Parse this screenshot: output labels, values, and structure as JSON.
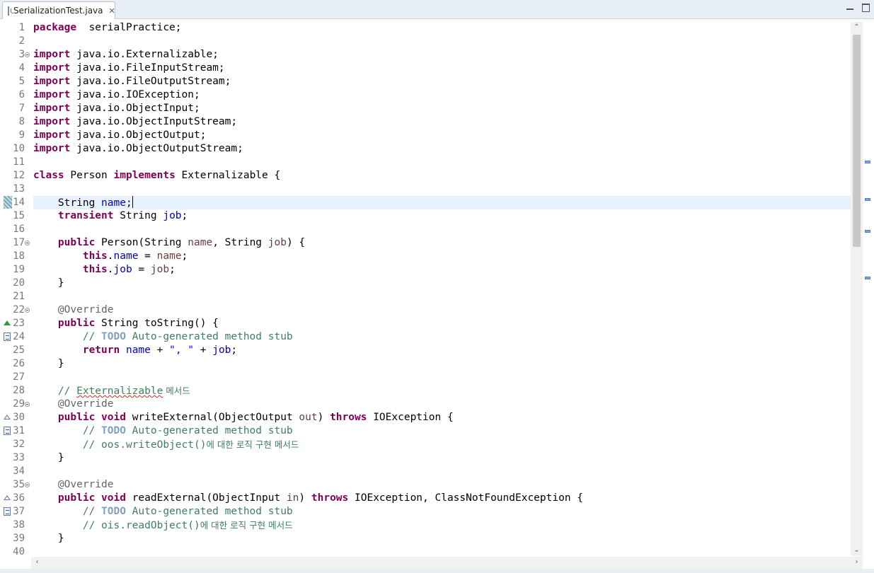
{
  "tab": {
    "title": "SerializationTest.java",
    "close_icon": "✕"
  },
  "window_buttons": {
    "minimize": "minimize",
    "maximize": "maximize"
  },
  "lines": [
    {
      "n": "1",
      "tokens": [
        [
          "kw",
          "package"
        ],
        [
          "",
          "  serialPractice;"
        ]
      ]
    },
    {
      "n": "2",
      "tokens": []
    },
    {
      "n": "3",
      "fold": true,
      "tokens": [
        [
          "kw",
          "import"
        ],
        [
          "",
          " java.io.Externalizable;"
        ]
      ]
    },
    {
      "n": "4",
      "tokens": [
        [
          "kw",
          "import"
        ],
        [
          "",
          " java.io.FileInputStream;"
        ]
      ]
    },
    {
      "n": "5",
      "tokens": [
        [
          "kw",
          "import"
        ],
        [
          "",
          " java.io.FileOutputStream;"
        ]
      ]
    },
    {
      "n": "6",
      "tokens": [
        [
          "kw",
          "import"
        ],
        [
          "",
          " java.io.IOException;"
        ]
      ]
    },
    {
      "n": "7",
      "tokens": [
        [
          "kw",
          "import"
        ],
        [
          "",
          " java.io.ObjectInput;"
        ]
      ]
    },
    {
      "n": "8",
      "tokens": [
        [
          "kw",
          "import"
        ],
        [
          "",
          " java.io.ObjectInputStream;"
        ]
      ]
    },
    {
      "n": "9",
      "tokens": [
        [
          "kw",
          "import"
        ],
        [
          "",
          " java.io.ObjectOutput;"
        ]
      ]
    },
    {
      "n": "10",
      "tokens": [
        [
          "kw",
          "import"
        ],
        [
          "",
          " java.io.ObjectOutputStream;"
        ]
      ]
    },
    {
      "n": "11",
      "tokens": []
    },
    {
      "n": "12",
      "tokens": [
        [
          "kw",
          "class"
        ],
        [
          "",
          " Person "
        ],
        [
          "kw",
          "implements"
        ],
        [
          "",
          " Externalizable {"
        ]
      ]
    },
    {
      "n": "13",
      "tokens": []
    },
    {
      "n": "14",
      "current": true,
      "marker": "cursor",
      "tokens": [
        [
          "",
          "    String "
        ],
        [
          "fld",
          "name"
        ],
        [
          "",
          ";"
        ],
        [
          "caret",
          ""
        ]
      ]
    },
    {
      "n": "15",
      "tokens": [
        [
          "",
          "    "
        ],
        [
          "kw",
          "transient"
        ],
        [
          "",
          " String "
        ],
        [
          "fld",
          "job"
        ],
        [
          "",
          ";"
        ]
      ]
    },
    {
      "n": "16",
      "tokens": []
    },
    {
      "n": "17",
      "fold": true,
      "tokens": [
        [
          "",
          "    "
        ],
        [
          "kw",
          "public"
        ],
        [
          "",
          " Person(String "
        ],
        [
          "prm",
          "name"
        ],
        [
          "",
          ", String "
        ],
        [
          "prm",
          "job"
        ],
        [
          "",
          ") {"
        ]
      ]
    },
    {
      "n": "18",
      "tokens": [
        [
          "",
          "        "
        ],
        [
          "kw",
          "this"
        ],
        [
          "",
          "."
        ],
        [
          "fld",
          "name"
        ],
        [
          "",
          " = "
        ],
        [
          "prm",
          "name"
        ],
        [
          "",
          ";"
        ]
      ]
    },
    {
      "n": "19",
      "tokens": [
        [
          "",
          "        "
        ],
        [
          "kw",
          "this"
        ],
        [
          "",
          "."
        ],
        [
          "fld",
          "job"
        ],
        [
          "",
          " = "
        ],
        [
          "prm",
          "job"
        ],
        [
          "",
          ";"
        ]
      ]
    },
    {
      "n": "20",
      "tokens": [
        [
          "",
          "    }"
        ]
      ]
    },
    {
      "n": "21",
      "tokens": []
    },
    {
      "n": "22",
      "fold": true,
      "tokens": [
        [
          "",
          "    "
        ],
        [
          "ann",
          "@Override"
        ]
      ]
    },
    {
      "n": "23",
      "marker": "override-up",
      "tokens": [
        [
          "",
          "    "
        ],
        [
          "kw",
          "public"
        ],
        [
          "",
          " String toString() {"
        ]
      ]
    },
    {
      "n": "24",
      "marker": "task",
      "tokens": [
        [
          "cmt",
          "        // "
        ],
        [
          "todo",
          "TODO"
        ],
        [
          "cmt",
          " Auto-generated method stub"
        ]
      ]
    },
    {
      "n": "25",
      "tokens": [
        [
          "",
          "        "
        ],
        [
          "kw",
          "return"
        ],
        [
          "",
          " "
        ],
        [
          "fld",
          "name"
        ],
        [
          "",
          " + "
        ],
        [
          "str",
          "\", \""
        ],
        [
          "",
          " + "
        ],
        [
          "fld",
          "job"
        ],
        [
          "",
          ";"
        ]
      ]
    },
    {
      "n": "26",
      "tokens": [
        [
          "",
          "    }"
        ]
      ]
    },
    {
      "n": "27",
      "tokens": []
    },
    {
      "n": "28",
      "tokens": [
        [
          "cmt",
          "    // "
        ],
        [
          "cmt squig",
          "Externalizable"
        ],
        [
          "cmt ko",
          " 메서드"
        ]
      ]
    },
    {
      "n": "29",
      "fold": true,
      "tokens": [
        [
          "",
          "    "
        ],
        [
          "ann",
          "@Override"
        ]
      ]
    },
    {
      "n": "30",
      "marker": "implement-up",
      "tokens": [
        [
          "",
          "    "
        ],
        [
          "kw",
          "public"
        ],
        [
          "",
          " "
        ],
        [
          "kw",
          "void"
        ],
        [
          "",
          " writeExternal(ObjectOutput "
        ],
        [
          "prm",
          "out"
        ],
        [
          "",
          ") "
        ],
        [
          "kw",
          "throws"
        ],
        [
          "",
          " IOException {"
        ]
      ]
    },
    {
      "n": "31",
      "marker": "task",
      "tokens": [
        [
          "cmt",
          "        // "
        ],
        [
          "todo",
          "TODO"
        ],
        [
          "cmt",
          " Auto-generated method stub"
        ]
      ]
    },
    {
      "n": "32",
      "tokens": [
        [
          "cmt",
          "        // oos.writeObject()"
        ],
        [
          "cmt ko",
          "에 대한 로직 구현 메서드"
        ]
      ]
    },
    {
      "n": "33",
      "tokens": [
        [
          "",
          "    }"
        ]
      ]
    },
    {
      "n": "34",
      "tokens": []
    },
    {
      "n": "35",
      "fold": true,
      "tokens": [
        [
          "",
          "    "
        ],
        [
          "ann",
          "@Override"
        ]
      ]
    },
    {
      "n": "36",
      "marker": "implement-up",
      "tokens": [
        [
          "",
          "    "
        ],
        [
          "kw",
          "public"
        ],
        [
          "",
          " "
        ],
        [
          "kw",
          "void"
        ],
        [
          "",
          " readExternal(ObjectInput "
        ],
        [
          "prm",
          "in"
        ],
        [
          "",
          ") "
        ],
        [
          "kw",
          "throws"
        ],
        [
          "",
          " IOException, ClassNotFoundException {"
        ]
      ]
    },
    {
      "n": "37",
      "marker": "task",
      "tokens": [
        [
          "cmt",
          "        // "
        ],
        [
          "todo",
          "TODO"
        ],
        [
          "cmt",
          " Auto-generated method stub"
        ]
      ]
    },
    {
      "n": "38",
      "tokens": [
        [
          "cmt",
          "        // ois.readObject()"
        ],
        [
          "cmt ko",
          "에 대한 로직 구현 메서드"
        ]
      ]
    },
    {
      "n": "39",
      "tokens": [
        [
          "",
          "    }"
        ]
      ]
    },
    {
      "n": "40",
      "tokens": []
    }
  ],
  "scrollbar": {
    "up_arrow": "⌃",
    "down_arrow": "⌄",
    "left_arrow": "‹",
    "right_arrow": "›"
  },
  "overview_markers": [
    "occurrence",
    "occurrence",
    "occurrence",
    "occurrence"
  ]
}
